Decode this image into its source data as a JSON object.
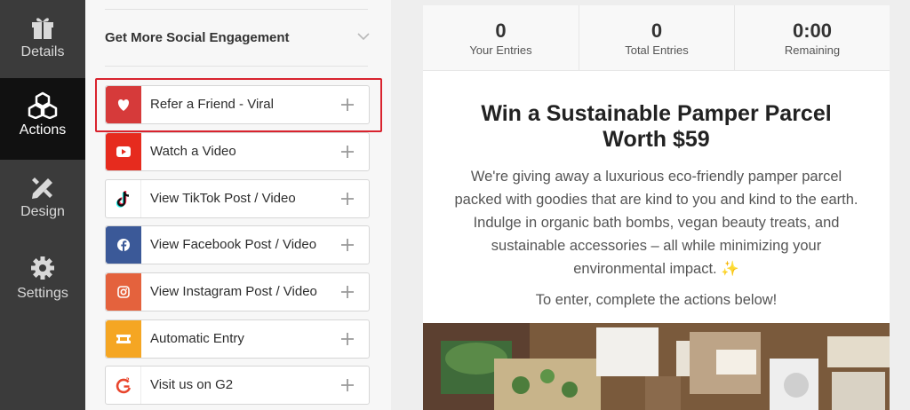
{
  "nav": {
    "items": [
      {
        "label": "Details",
        "icon": "gift-icon"
      },
      {
        "label": "Actions",
        "icon": "cubes-icon"
      },
      {
        "label": "Design",
        "icon": "pencil-ruler-icon"
      },
      {
        "label": "Settings",
        "icon": "gear-icon"
      }
    ],
    "active": "Actions"
  },
  "actions_panel": {
    "section_title": "Get More Social Engagement",
    "items": [
      {
        "label": "Refer a Friend - Viral",
        "icon": "heart-icon",
        "color": "#d63a3a",
        "highlighted": true
      },
      {
        "label": "Watch a Video",
        "icon": "youtube-icon",
        "color": "#e62b1e"
      },
      {
        "label": "View TikTok Post / Video",
        "icon": "tiktok-icon",
        "color": "#ffffff"
      },
      {
        "label": "View Facebook Post / Video",
        "icon": "facebook-icon",
        "color": "#3b5998"
      },
      {
        "label": "View Instagram Post / Video",
        "icon": "instagram-icon",
        "color": "#e4623d"
      },
      {
        "label": "Automatic Entry",
        "icon": "ticket-icon",
        "color": "#f5a623"
      },
      {
        "label": "Visit us on G2",
        "icon": "g2-icon",
        "color": "#ffffff"
      }
    ]
  },
  "preview": {
    "stats": [
      {
        "value": "0",
        "label": "Your Entries"
      },
      {
        "value": "0",
        "label": "Total Entries"
      },
      {
        "value": "0:00",
        "label": "Remaining"
      }
    ],
    "title": "Win a Sustainable Pamper Parcel Worth $59",
    "description": "We're giving away a luxurious eco-friendly pamper parcel packed with goodies that are kind to you and kind to the earth. Indulge in organic bath bombs, vegan beauty treats, and sustainable accessories – all while minimizing your environmental impact. ✨",
    "enter_text": "To enter, complete the actions below!"
  },
  "colors": {
    "highlight": "#d9232e",
    "nav_bg": "#3b3b3b",
    "nav_active": "#111111"
  }
}
